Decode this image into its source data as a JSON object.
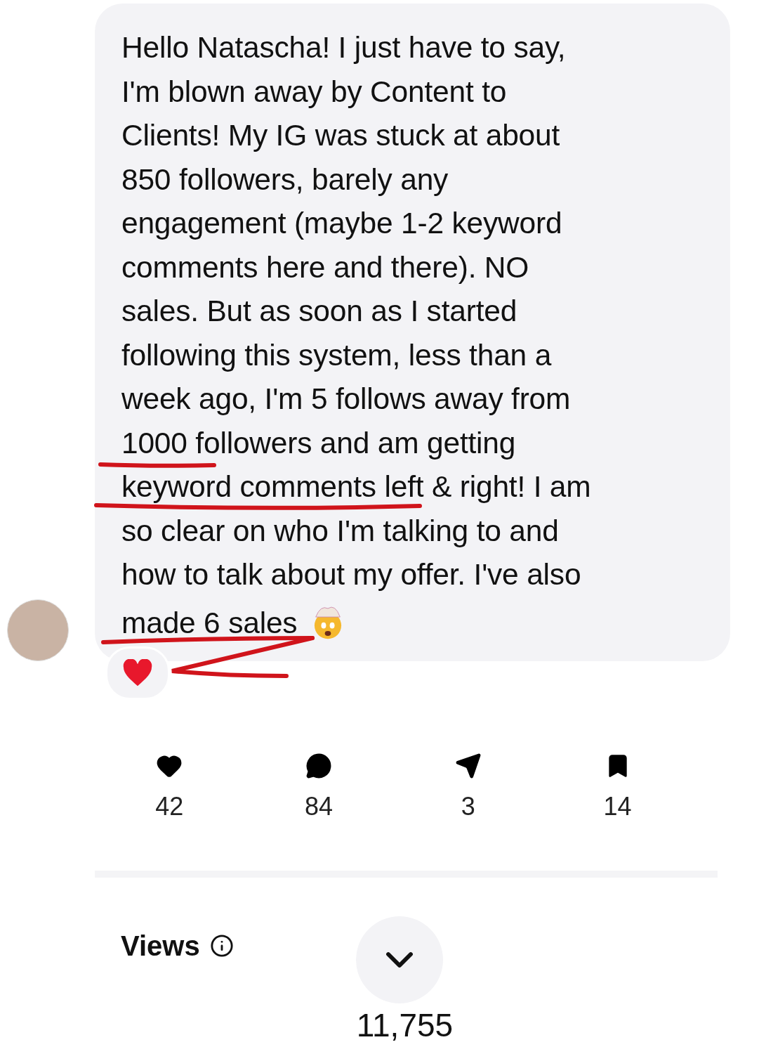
{
  "message": {
    "lines": [
      "Hello Natascha! I just have to say,",
      "I'm blown away by Content to",
      "Clients! My IG was stuck at about",
      "850 followers, barely any",
      "engagement (maybe 1-2 keyword",
      "comments here and there). NO",
      "sales. But as soon as I started",
      "following this system, less than a",
      "week ago, I'm 5 follows away from",
      "1000 followers and am getting",
      "keyword comments left & right! I am",
      "so clear on who I'm talking to and",
      "how to talk about my offer. I've also",
      "made 6 sales"
    ]
  },
  "stats": [
    {
      "kind": "like",
      "count": "42"
    },
    {
      "kind": "comment",
      "count": "84"
    },
    {
      "kind": "share",
      "count": "3"
    },
    {
      "kind": "save",
      "count": "14"
    }
  ],
  "views": {
    "label": "Views",
    "count": "11,755"
  }
}
